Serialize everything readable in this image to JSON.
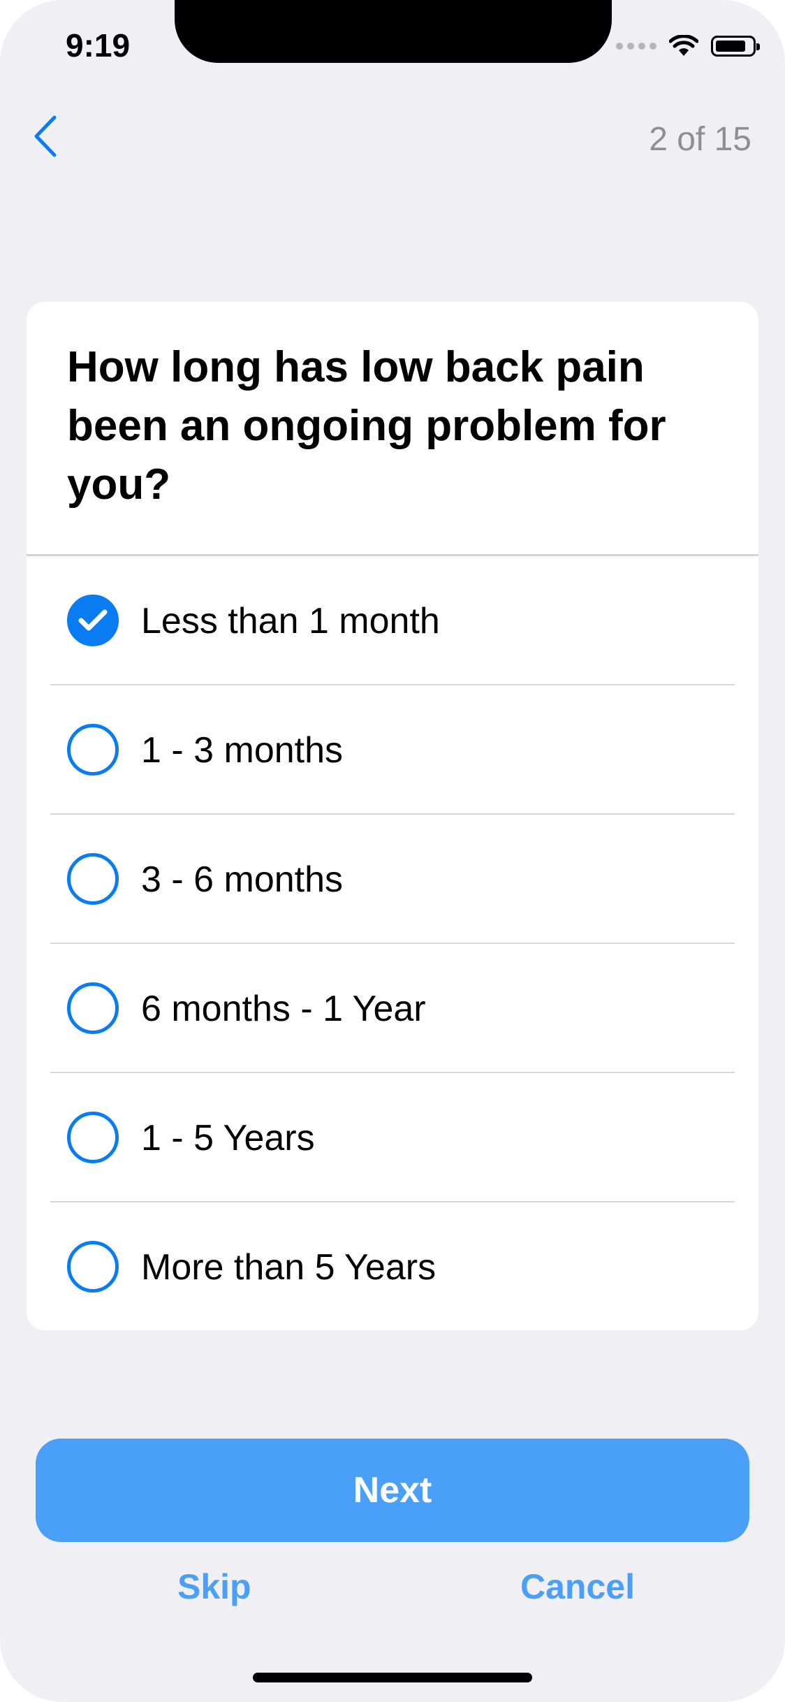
{
  "status_bar": {
    "time": "9:19",
    "icons": [
      "cellular-signal-icon",
      "wifi-icon",
      "battery-icon"
    ]
  },
  "header": {
    "back_icon": "chevron-left-icon",
    "step_counter": "2 of 15"
  },
  "question": {
    "text": "How long has low back pain been an ongoing problem for you?"
  },
  "options": [
    {
      "label": "Less than 1 month",
      "selected": true
    },
    {
      "label": "1 - 3 months",
      "selected": false
    },
    {
      "label": "3 - 6 months",
      "selected": false
    },
    {
      "label": "6 months - 1 Year",
      "selected": false
    },
    {
      "label": "1 - 5 Years",
      "selected": false
    },
    {
      "label": "More than 5 Years",
      "selected": false
    }
  ],
  "actions": {
    "next_label": "Next",
    "skip_label": "Skip",
    "cancel_label": "Cancel"
  },
  "colors": {
    "accent": "#0a7cf2",
    "button": "#4a9ff8",
    "background": "#efeff4",
    "secondary_text": "#8e8e93"
  }
}
